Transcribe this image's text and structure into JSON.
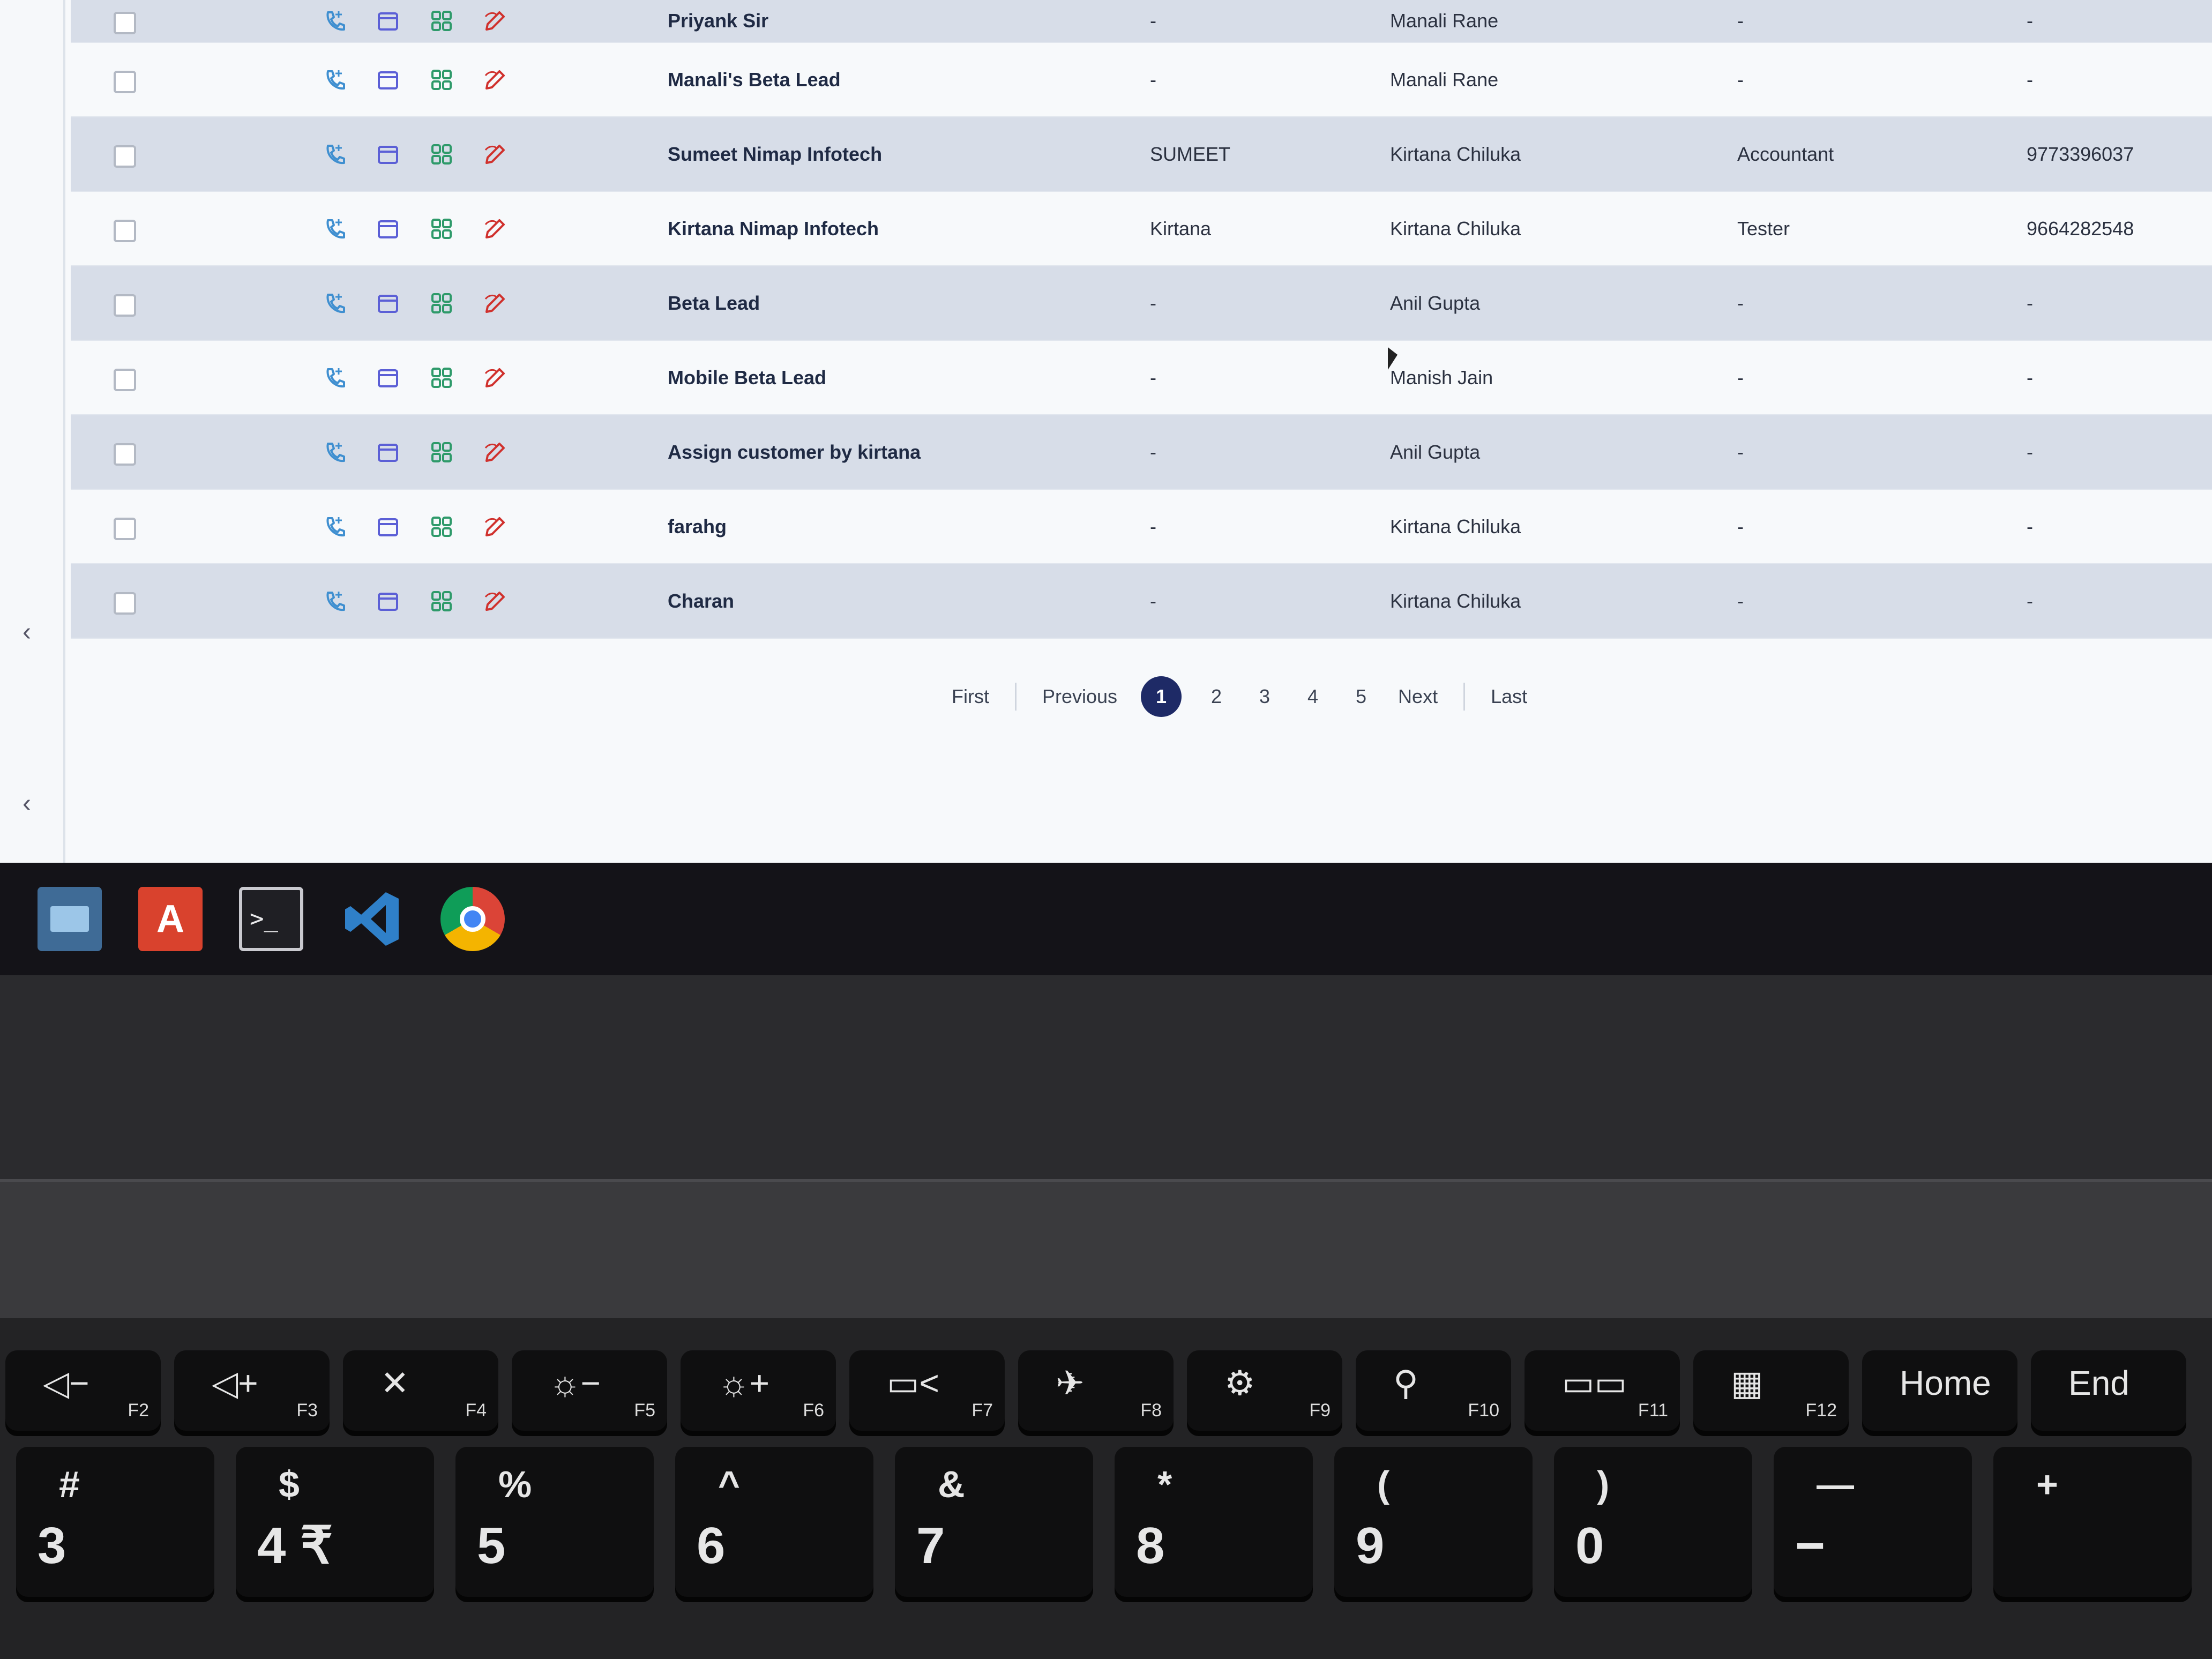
{
  "rows": [
    {
      "name": "Priyank Sir",
      "col2": "-",
      "col3": "Manali Rane",
      "col4": "-",
      "col5": "-"
    },
    {
      "name": "Manali's Beta Lead",
      "col2": "-",
      "col3": "Manali Rane",
      "col4": "-",
      "col5": "-"
    },
    {
      "name": "Sumeet Nimap Infotech",
      "col2": "SUMEET",
      "col3": "Kirtana Chiluka",
      "col4": "Accountant",
      "col5": "9773396037"
    },
    {
      "name": "Kirtana Nimap Infotech",
      "col2": "Kirtana",
      "col3": "Kirtana Chiluka",
      "col4": "Tester",
      "col5": "9664282548"
    },
    {
      "name": "Beta Lead",
      "col2": "-",
      "col3": "Anil Gupta",
      "col4": "-",
      "col5": "-"
    },
    {
      "name": "Mobile Beta Lead",
      "col2": "-",
      "col3": "Manish Jain",
      "col4": "-",
      "col5": "-"
    },
    {
      "name": "Assign customer by kirtana",
      "col2": "-",
      "col3": "Anil Gupta",
      "col4": "-",
      "col5": "-"
    },
    {
      "name": "farahg",
      "col2": "-",
      "col3": "Kirtana Chiluka",
      "col4": "-",
      "col5": "-"
    },
    {
      "name": "Charan",
      "col2": "-",
      "col3": "Kirtana Chiluka",
      "col4": "-",
      "col5": "-"
    }
  ],
  "pagination": {
    "first": "First",
    "previous": "Previous",
    "pages": [
      "1",
      "2",
      "3",
      "4",
      "5"
    ],
    "current": "1",
    "next": "Next",
    "last": "Last"
  },
  "icons": {
    "call": "phone-icon",
    "calendar": "calendar-icon",
    "grid": "grid-icon",
    "edit": "edit-icon"
  },
  "colors": {
    "call": "#3f8fd0",
    "calendar": "#5b5fd6",
    "grid": "#2e9a6a",
    "edit": "#d0312d",
    "pager_active": "#1e2a66"
  },
  "taskbar": {
    "apps": [
      "file-manager",
      "app-store",
      "terminal",
      "vscode",
      "chrome"
    ],
    "terminal_prompt": ">_",
    "appstore_glyph": "A"
  },
  "keyboard": {
    "fkeys": [
      {
        "glyph": "◁−",
        "label": "F2"
      },
      {
        "glyph": "◁+",
        "label": "F3"
      },
      {
        "glyph": "✕",
        "label": "F4"
      },
      {
        "glyph": "☼−",
        "label": "F5"
      },
      {
        "glyph": "☼+",
        "label": "F6"
      },
      {
        "glyph": "▭<",
        "label": "F7"
      },
      {
        "glyph": "✈",
        "label": "F8"
      },
      {
        "glyph": "⚙",
        "label": "F9"
      },
      {
        "glyph": "⚲",
        "label": "F10"
      },
      {
        "glyph": "▭▭",
        "label": "F11"
      },
      {
        "glyph": "▦",
        "label": "F12"
      },
      {
        "glyph": "Home",
        "label": ""
      },
      {
        "glyph": "End",
        "label": ""
      }
    ],
    "numkeys": [
      {
        "top": "#",
        "main": "3"
      },
      {
        "top": "$",
        "main": "4 ₹"
      },
      {
        "top": "%",
        "main": "5"
      },
      {
        "top": "^",
        "main": "6"
      },
      {
        "top": "&",
        "main": "7"
      },
      {
        "top": "*",
        "main": "8"
      },
      {
        "top": "(",
        "main": "9"
      },
      {
        "top": ")",
        "main": "0"
      },
      {
        "top": "—",
        "main": "−"
      },
      {
        "top": "+",
        "main": ""
      }
    ]
  }
}
